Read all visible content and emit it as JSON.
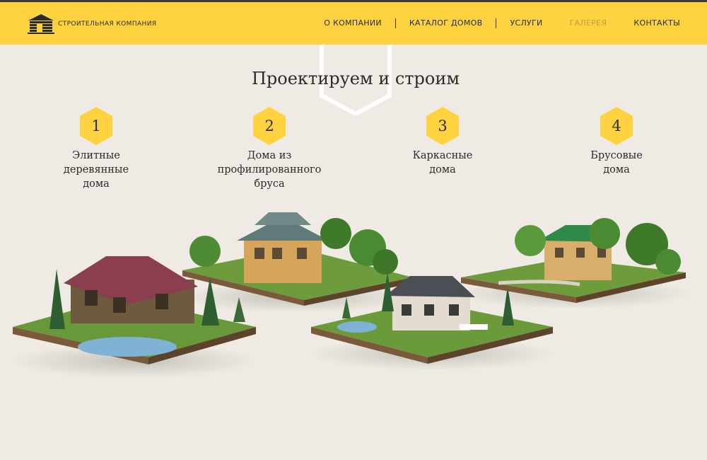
{
  "header": {
    "logo_text": "Строительная компания",
    "brand_color": "#ffd23f",
    "nav": [
      {
        "label": "О КОМПАНИИ",
        "active": false
      },
      {
        "label": "КАТАЛОГ ДОМОВ",
        "active": false
      },
      {
        "label": "УСЛУГИ",
        "active": false
      },
      {
        "label": "ГАЛЕРЕЯ",
        "active": true
      },
      {
        "label": "КОНТАКТЫ",
        "active": false
      }
    ]
  },
  "main": {
    "title": "Проектируем и строим",
    "features": [
      {
        "number": "1",
        "label": "Элитные\nдеревянные\nдома"
      },
      {
        "number": "2",
        "label": "Дома из\nпрофилированного\nбруса"
      },
      {
        "number": "3",
        "label": "Каркасные\nдома"
      },
      {
        "number": "4",
        "label": "Брусовые\nдома"
      }
    ]
  }
}
